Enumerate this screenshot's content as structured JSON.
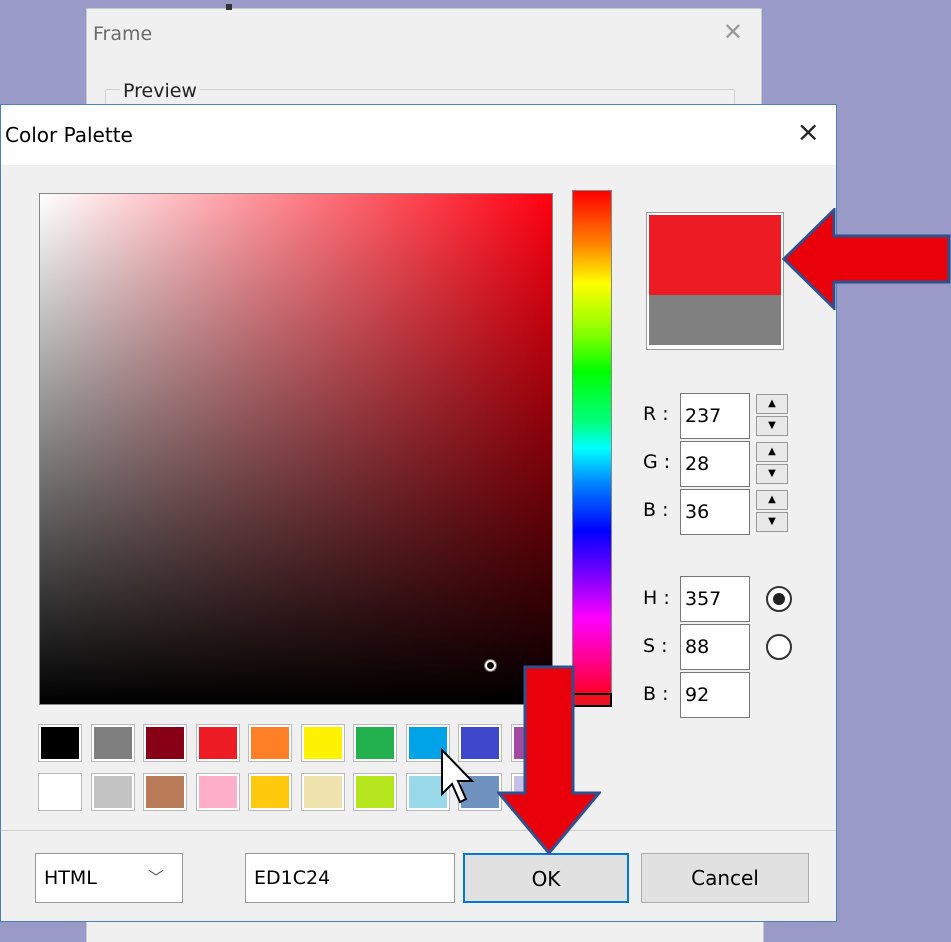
{
  "background_window": {
    "title": "Frame",
    "preview_label": "Preview"
  },
  "dialog": {
    "title": "Color Palette",
    "close_symbol": "×"
  },
  "picker": {
    "hue_color": "#ff0010",
    "new_color": "#ED1C24",
    "old_color": "#808080"
  },
  "rgb": {
    "r_label": "R :",
    "g_label": "G :",
    "b_label": "B :",
    "r": "237",
    "g": "28",
    "b": "36"
  },
  "hsb": {
    "h_label": "H :",
    "s_label": "S :",
    "b_label": "B :",
    "h": "357",
    "s": "88",
    "b": "92",
    "selected_radio": "H"
  },
  "swatches": {
    "row1": [
      "#000000",
      "#7f7f7f",
      "#880015",
      "#ed1c24",
      "#ff7f27",
      "#fff200",
      "#22b14c",
      "#00a2e8",
      "#3f48cc",
      "#a349a4"
    ],
    "row2": [
      "#ffffff",
      "#c3c3c3",
      "#b97a57",
      "#ffaec9",
      "#ffc90e",
      "#efe4b0",
      "#b5e61d",
      "#99d9ea",
      "#7092be",
      "#c8bfe7"
    ]
  },
  "footer": {
    "format_select": "HTML",
    "hex_value": "ED1C24",
    "ok_label": "OK",
    "cancel_label": "Cancel"
  },
  "annotations": {
    "arrow_color": "#e8000a",
    "arrow_outline": "#2f4f8f"
  }
}
